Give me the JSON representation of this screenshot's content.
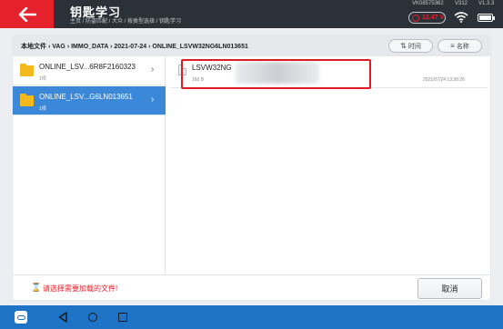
{
  "header": {
    "title": "钥匙学习",
    "breadcrumb": "主页 / 防盗匹配 / 大众 / 按类型选择 / 钥匙学习",
    "vin": "VK08575362",
    "device": "V312",
    "version": "V1.3.3",
    "voltage": "12.47 V"
  },
  "path_bar": {
    "path": "本地文件 › VAG › IMMO_DATA › 2021-07-24 › ONLINE_LSVW32NG6LN013651",
    "sort_time_label": "时间",
    "sort_name_label": "名称"
  },
  "folders": [
    {
      "name": "ONLINE_LSV...6R8F2160323",
      "count": "1项"
    },
    {
      "name": "ONLINE_LSV...G6LN013651",
      "count": "1项"
    }
  ],
  "file": {
    "name": "LSVW32NG",
    "size": "160 B",
    "date": "2021/07/24 13:38:26"
  },
  "footer": {
    "warning": "请选择需要加载的文件!",
    "cancel_label": "取消"
  },
  "colors": {
    "accent": "#e5212c",
    "header_bg": "#2b3138",
    "selected_bg": "#3b88d9",
    "navbar_bg": "#1e73c7"
  }
}
